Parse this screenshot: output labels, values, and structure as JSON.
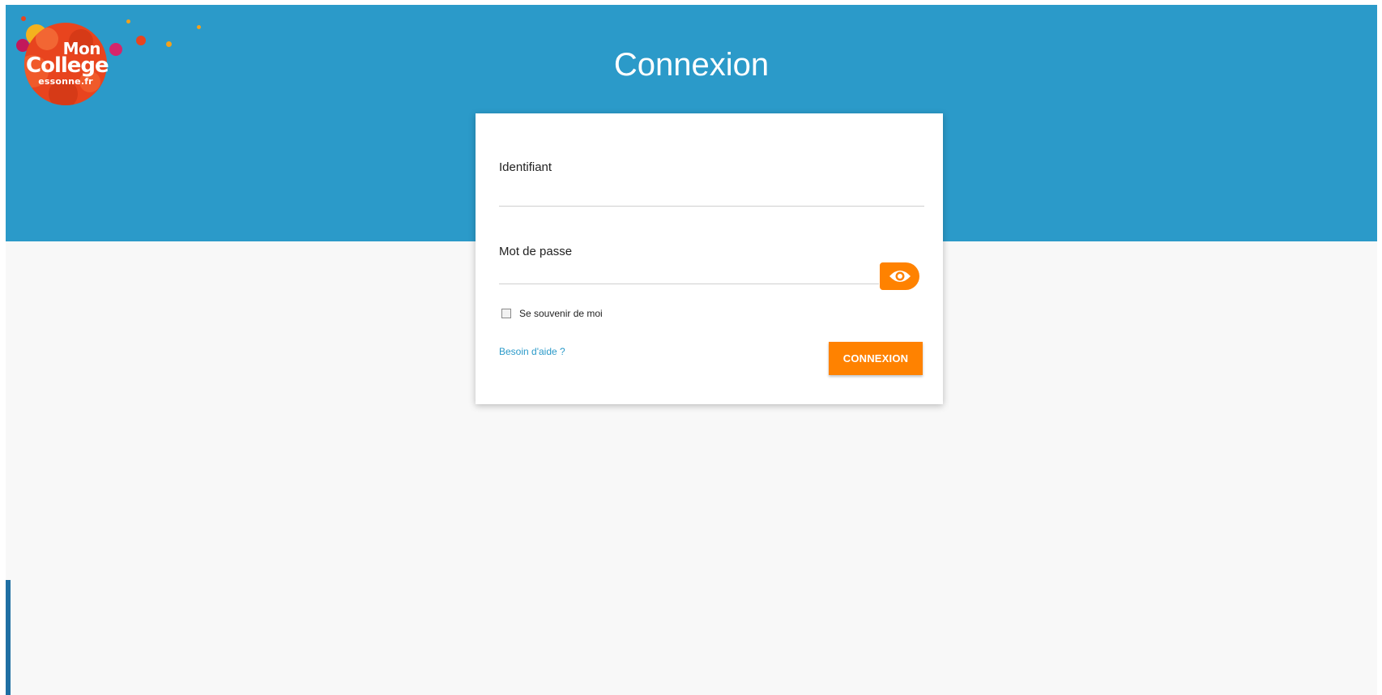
{
  "logo": {
    "line1": "Mon",
    "line2": "College",
    "line3": "essonne.fr"
  },
  "header": {
    "title": "Connexion"
  },
  "form": {
    "username_label": "Identifiant",
    "username_value": "",
    "password_label": "Mot de passe",
    "password_value": "",
    "show_password_icon": "eye-icon",
    "remember_label": "Se souvenir de moi",
    "remember_checked": false,
    "help_link": "Besoin d'aide ?",
    "submit_label": "CONNEXION"
  },
  "colors": {
    "header_bg": "#2b9ac9",
    "accent": "#ff8200",
    "page_bg": "#f8f8f8",
    "link": "#2b9ac9",
    "logo_red": "#e8441e"
  }
}
